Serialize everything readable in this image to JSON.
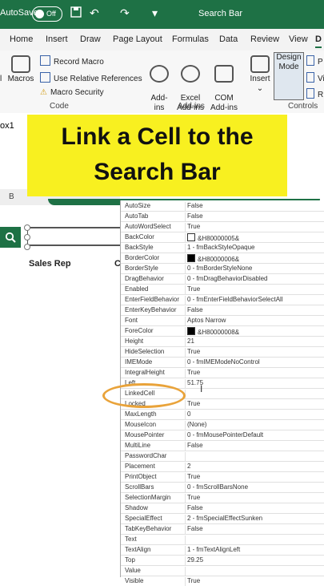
{
  "titlebar": {
    "autosave_label": "AutoSave",
    "toggle_state": "Off",
    "doc_title": "Search Bar",
    "bg_color": "#1e7145"
  },
  "ribbon_tabs": [
    "Home",
    "Insert",
    "Draw",
    "Page Layout",
    "Formulas",
    "Data",
    "Review",
    "View",
    "D"
  ],
  "ribbon": {
    "code": {
      "macros_label": "Macros",
      "record_macro": "Record Macro",
      "use_relative": "Use Relative References",
      "macro_security": "Macro Security",
      "group_label": "Code",
      "partial_left": "l"
    },
    "addins": {
      "addins_label": "Add-\nins",
      "excel_addins_label": "Excel\nAdd-ins",
      "com_addins_label": "COM\nAdd-ins",
      "group_label": "Add-ins"
    },
    "controls": {
      "insert_label": "Insert",
      "design_mode_label": "Design\nMode",
      "p_label": "P",
      "vi_label": "Vi",
      "ru_label": "R",
      "group_label": "Controls"
    }
  },
  "formula_bar": {
    "name_box": "ox1"
  },
  "sheet": {
    "col_b": "B",
    "sales_rep": "Sales Rep",
    "col_c": "C"
  },
  "banner": {
    "text": "Link a Cell to the Search Bar",
    "line1": "Link a Cell to the",
    "line2": "Search Bar"
  },
  "properties": [
    {
      "name": "AutoSize",
      "value": "False"
    },
    {
      "name": "AutoTab",
      "value": "False"
    },
    {
      "name": "AutoWordSelect",
      "value": "True"
    },
    {
      "name": "BackColor",
      "value": "&H80000005&",
      "swatch": "#ffffff"
    },
    {
      "name": "BackStyle",
      "value": "1 - fmBackStyleOpaque"
    },
    {
      "name": "BorderColor",
      "value": "&H80000006&",
      "swatch": "#000000"
    },
    {
      "name": "BorderStyle",
      "value": "0 - fmBorderStyleNone"
    },
    {
      "name": "DragBehavior",
      "value": "0 - fmDragBehaviorDisabled"
    },
    {
      "name": "Enabled",
      "value": "True"
    },
    {
      "name": "EnterFieldBehavior",
      "value": "0 - fmEnterFieldBehaviorSelectAll"
    },
    {
      "name": "EnterKeyBehavior",
      "value": "False"
    },
    {
      "name": "Font",
      "value": "Aptos Narrow"
    },
    {
      "name": "ForeColor",
      "value": "&H80000008&",
      "swatch": "#000000"
    },
    {
      "name": "Height",
      "value": "21"
    },
    {
      "name": "HideSelection",
      "value": "True"
    },
    {
      "name": "IMEMode",
      "value": "0 - fmIMEModeNoControl"
    },
    {
      "name": "IntegralHeight",
      "value": "True"
    },
    {
      "name": "Left",
      "value": "51.75"
    },
    {
      "name": "LinkedCell",
      "value": ""
    },
    {
      "name": "Locked",
      "value": "True"
    },
    {
      "name": "MaxLength",
      "value": "0"
    },
    {
      "name": "MouseIcon",
      "value": "(None)"
    },
    {
      "name": "MousePointer",
      "value": "0 - fmMousePointerDefault"
    },
    {
      "name": "MultiLine",
      "value": "False"
    },
    {
      "name": "PasswordChar",
      "value": ""
    },
    {
      "name": "Placement",
      "value": "2"
    },
    {
      "name": "PrintObject",
      "value": "True"
    },
    {
      "name": "ScrollBars",
      "value": "0 - fmScrollBarsNone"
    },
    {
      "name": "SelectionMargin",
      "value": "True"
    },
    {
      "name": "Shadow",
      "value": "False"
    },
    {
      "name": "SpecialEffect",
      "value": "2 - fmSpecialEffectSunken"
    },
    {
      "name": "TabKeyBehavior",
      "value": "False"
    },
    {
      "name": "Text",
      "value": ""
    },
    {
      "name": "TextAlign",
      "value": "1 - fmTextAlignLeft"
    },
    {
      "name": "Top",
      "value": "29.25"
    },
    {
      "name": "Value",
      "value": ""
    },
    {
      "name": "Visible",
      "value": "True"
    }
  ],
  "colors": {
    "accent": "#1e7145",
    "banner": "#f8f020",
    "highlight": "#e9a33a"
  }
}
